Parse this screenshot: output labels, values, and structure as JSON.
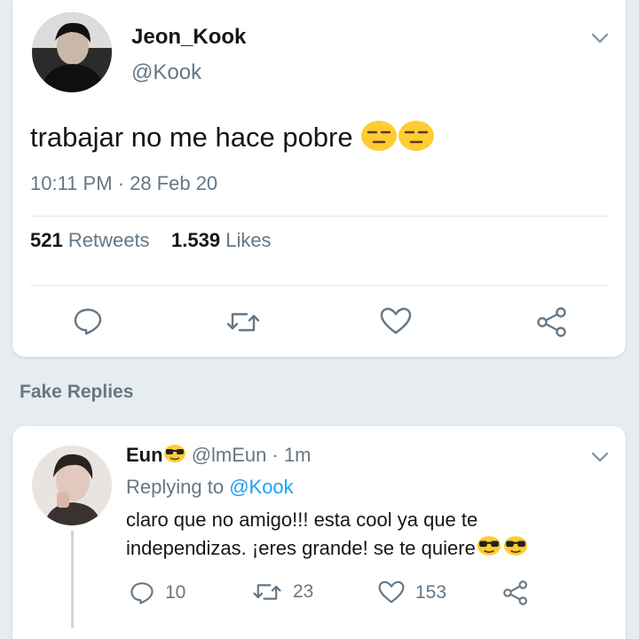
{
  "tweet": {
    "display_name": "Jeon_Kook",
    "handle": "@Kook",
    "text": "trabajar no me hace pobre",
    "emoji": [
      "unamused-face",
      "unamused-face"
    ],
    "timestamp": "10:11 PM · 28 Feb 20",
    "retweets_count": "521",
    "retweets_label": "Retweets",
    "likes_count": "1.539",
    "likes_label": "Likes"
  },
  "section_label": "Fake Replies",
  "reply": {
    "display_name": "Eun",
    "name_emoji": "sunglasses-face",
    "handle": "@lmEun",
    "time": " · 1m",
    "replying_prefix": "Replying to ",
    "replying_to": "@Kook",
    "text": "claro que no amigo!!! esta cool ya que te independizas. ¡eres grande! se te quiere",
    "text_emoji": [
      "sunglasses-face",
      "sunglasses-face"
    ],
    "reply_count": "10",
    "retweet_count": "23",
    "like_count": "153"
  },
  "colors": {
    "background": "#e6ecf0",
    "card": "#ffffff",
    "secondary_text": "#657786",
    "link": "#1da1f2",
    "icon": "#657786"
  }
}
